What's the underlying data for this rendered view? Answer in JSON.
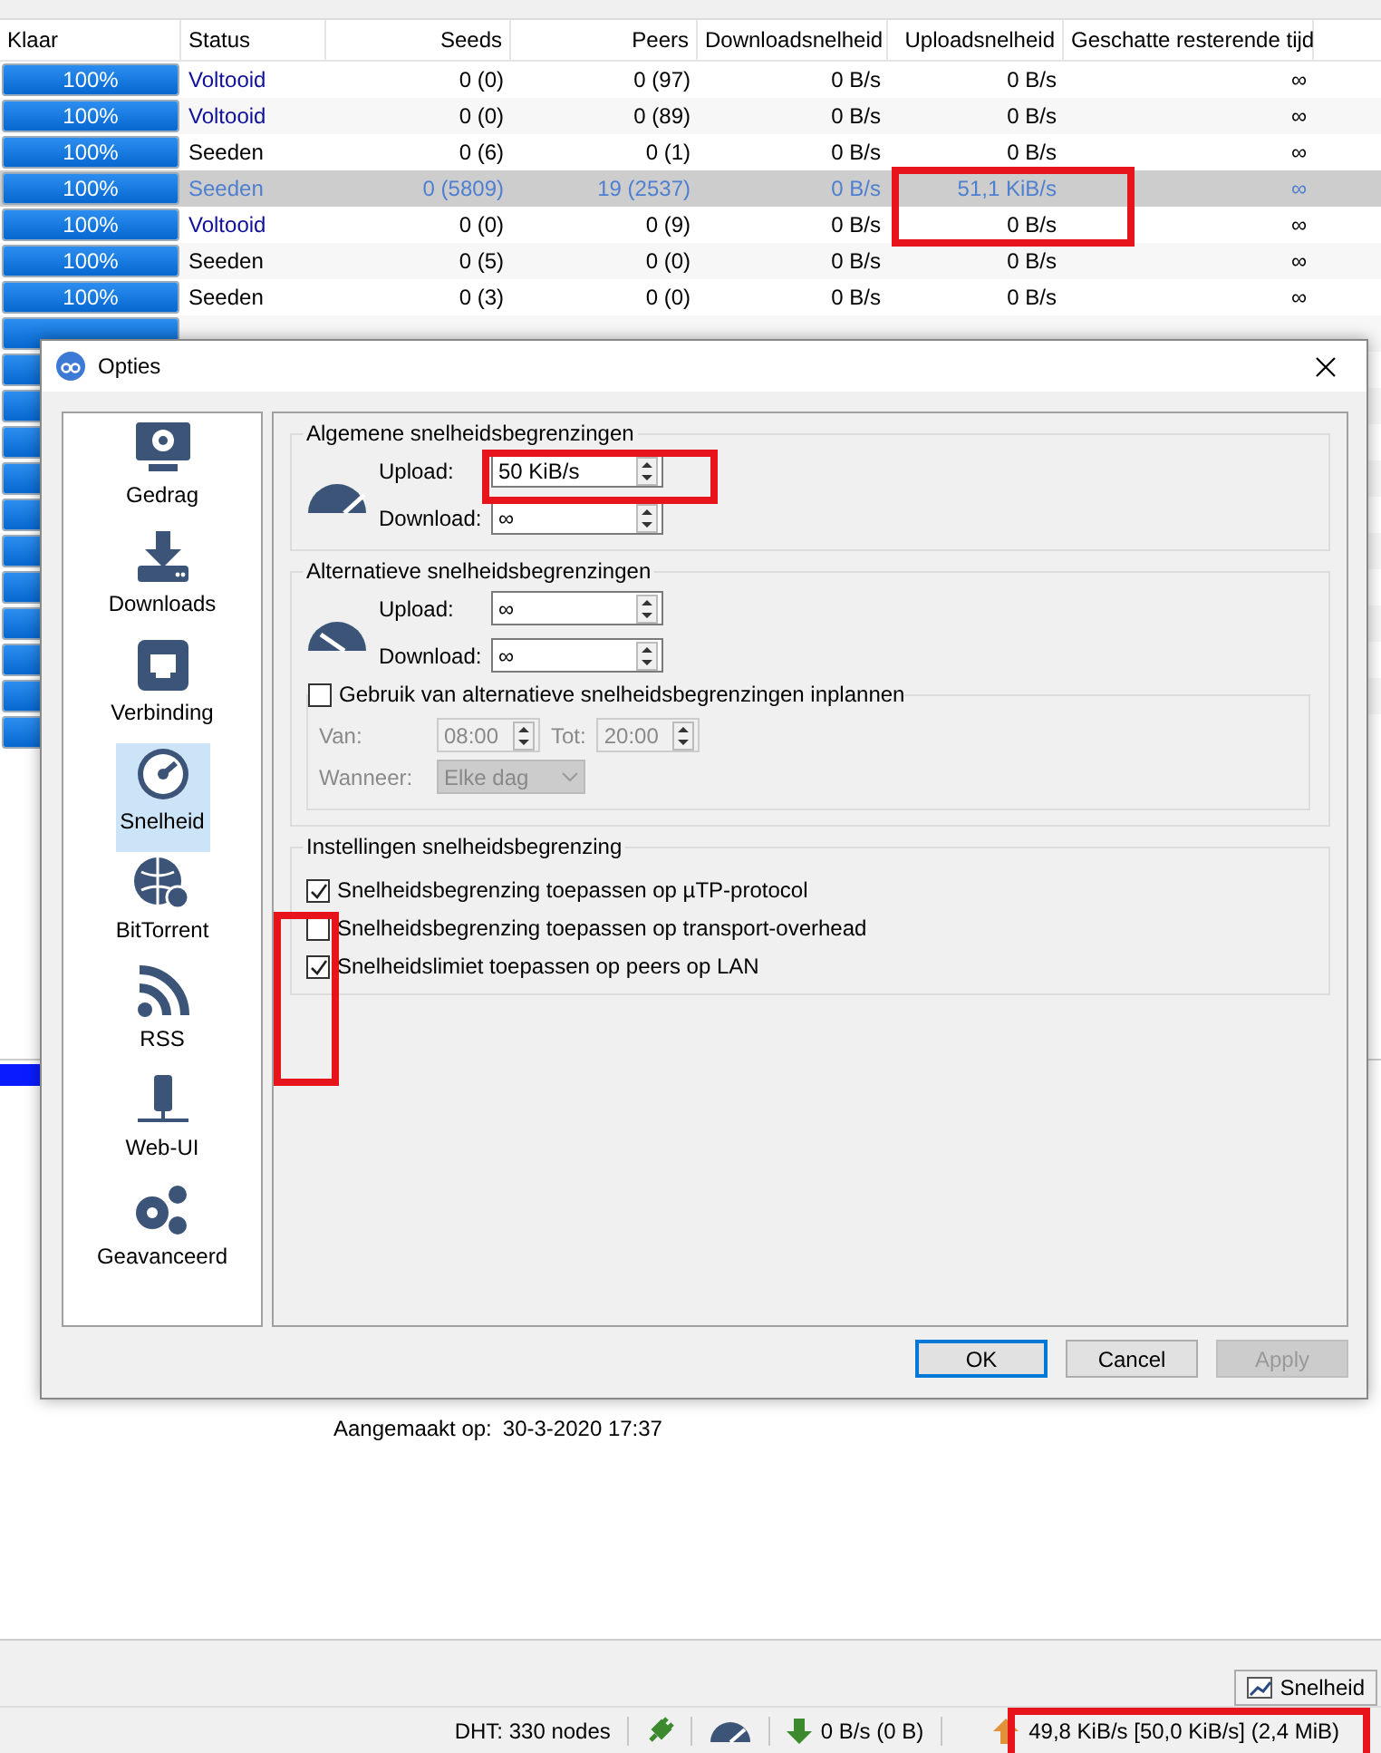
{
  "torrent_table": {
    "columns": [
      "Klaar",
      "Status",
      "Seeds",
      "Peers",
      "Downloadsnelheid",
      "Uploadsnelheid",
      "Geschatte resterende tijd"
    ],
    "rows": [
      {
        "kind": "completed",
        "level": 1,
        "progress": "100%",
        "status": "Voltooid",
        "seeds": "0 (0)",
        "peers": "0 (97)",
        "down": "0 B/s",
        "up": "0 B/s",
        "eta": "∞",
        "selected": false
      },
      {
        "kind": "completed",
        "level": 1,
        "progress": "100%",
        "status": "Voltooid",
        "seeds": "0 (0)",
        "peers": "0 (89)",
        "down": "0 B/s",
        "up": "0 B/s",
        "eta": "∞",
        "selected": false
      },
      {
        "kind": "seeding",
        "level": 1,
        "progress": "100%",
        "status": "Seeden",
        "seeds": "0 (6)",
        "peers": "0 (1)",
        "down": "0 B/s",
        "up": "0 B/s",
        "eta": "∞",
        "selected": false
      },
      {
        "kind": "seeding",
        "level": 1,
        "progress": "100%",
        "status": "Seeden",
        "seeds": "0 (5809)",
        "peers": "19 (2537)",
        "down": "0 B/s",
        "up": "51,1 KiB/s",
        "eta": "∞",
        "selected": true
      },
      {
        "kind": "completed",
        "level": 1,
        "progress": "100%",
        "status": "Voltooid",
        "seeds": "0 (0)",
        "peers": "0 (9)",
        "down": "0 B/s",
        "up": "0 B/s",
        "eta": "∞",
        "selected": false
      },
      {
        "kind": "seeding",
        "level": 1,
        "progress": "100%",
        "status": "Seeden",
        "seeds": "0 (5)",
        "peers": "0 (0)",
        "down": "0 B/s",
        "up": "0 B/s",
        "eta": "∞",
        "selected": false
      },
      {
        "kind": "seeding",
        "level": 1,
        "progress": "100%",
        "status": "Seeden",
        "seeds": "0 (3)",
        "peers": "0 (0)",
        "down": "0 B/s",
        "up": "0 B/s",
        "eta": "∞",
        "selected": false
      },
      {
        "kind": "covered",
        "level": 1
      },
      {
        "kind": "covered",
        "level": 1
      },
      {
        "kind": "covered",
        "level": 1
      },
      {
        "kind": "covered",
        "level": 1
      },
      {
        "kind": "covered",
        "level": 1
      },
      {
        "kind": "covered",
        "level": 1
      },
      {
        "kind": "covered",
        "level": 1
      },
      {
        "kind": "covered",
        "level": 1
      },
      {
        "kind": "covered",
        "level": 1
      },
      {
        "kind": "covered",
        "level": 1
      },
      {
        "kind": "covered",
        "level": 1
      },
      {
        "kind": "covered",
        "level": 1
      }
    ]
  },
  "details": {
    "created_label": "Aangemaakt op:",
    "created_value": "30-3-2020 17:37"
  },
  "graph_tab": {
    "label": "Snelheid"
  },
  "status_bar": {
    "dht": "DHT: 330 nodes",
    "download": "0 B/s (0 B)",
    "upload": "49,8 KiB/s [50,0 KiB/s] (2,4 MiB)"
  },
  "dialog": {
    "title": "Opties",
    "sidebar": [
      {
        "label": "Gedrag",
        "selected": false
      },
      {
        "label": "Downloads",
        "selected": false
      },
      {
        "label": "Verbinding",
        "selected": false
      },
      {
        "label": "Snelheid",
        "selected": true
      },
      {
        "label": "BitTorrent",
        "selected": false
      },
      {
        "label": "RSS",
        "selected": false
      },
      {
        "label": "Web-UI",
        "selected": false
      },
      {
        "label": "Geavanceerd",
        "selected": false
      }
    ],
    "groups": [
      {
        "kind": "limits",
        "title": "Algemene snelheidsbegrenzingen",
        "fields": [
          {
            "label": "Upload:",
            "value": "50 KiB/s"
          },
          {
            "label": "Download:",
            "value": "∞"
          }
        ]
      },
      {
        "kind": "alt_limits",
        "title": "Alternatieve snelheidsbegrenzingen",
        "fields": [
          {
            "label": "Upload:",
            "value": "∞"
          },
          {
            "label": "Download:",
            "value": "∞"
          }
        ],
        "schedule": {
          "label": "Gebruik van alternatieve snelheidsbegrenzingen inplannen",
          "checked": false,
          "times": [
            {
              "label": "Van:",
              "value": "08:00",
              "disabled": true
            },
            {
              "label": "Tot:",
              "value": "20:00",
              "disabled": true
            }
          ],
          "when": {
            "label": "Wanneer:",
            "value": "Elke dag",
            "disabled": true
          }
        }
      },
      {
        "kind": "checks",
        "title": "Instellingen snelheidsbegrenzing",
        "options": [
          {
            "label": "Snelheidsbegrenzing toepassen op µTP-protocol",
            "checked": true
          },
          {
            "label": "Snelheidsbegrenzing toepassen op transport-overhead",
            "checked": false
          },
          {
            "label": "Snelheidslimiet toepassen op peers op LAN",
            "checked": true
          }
        ]
      }
    ],
    "buttons": [
      {
        "label": "OK",
        "kind": "default",
        "disabled": false
      },
      {
        "label": "Cancel",
        "kind": "normal",
        "disabled": false
      },
      {
        "label": "Apply",
        "kind": "normal",
        "disabled": true
      }
    ]
  }
}
